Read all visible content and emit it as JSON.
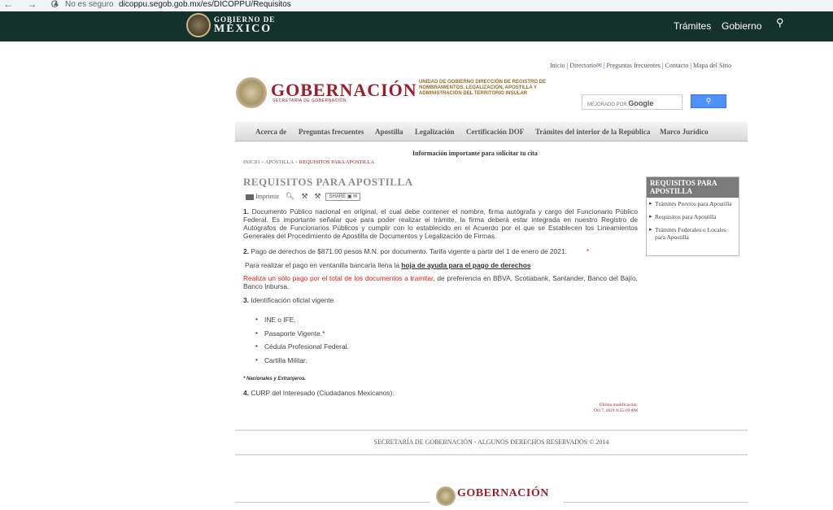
{
  "browser": {
    "nav": "← → C",
    "security": "No es seguro",
    "url": "dicoppu.segob.gob.mx/es/DICOPPU/Requisitos"
  },
  "govbar": {
    "line1": "GOBIERNO DE",
    "line2": "MÉXICO",
    "links": [
      "Trámites",
      "Gobierno"
    ],
    "search_icon": "search-icon"
  },
  "toplinks": [
    "Inicio",
    "Directorio",
    "Preguntas frecuentes",
    "Contacto",
    "Mapa del Sitio"
  ],
  "header": {
    "title": "GOBERNACIÓN",
    "subtitle": "SECRETARÍA DE GOBERNACIÓN",
    "unidad": "UNIDAD DE GOBIERNO DIRECCIÓN DE REGISTRO DE NOMBRAMIENTOS, LEGALIZACIÓN, APOSTILLA Y ADMINISTRACIÓN DEL TERRITORIO INSULAR",
    "search_label": "MEJORADO POR",
    "search_brand": "Google"
  },
  "menu": [
    "Acerca de",
    "Preguntas frecuentes",
    "Apostilla",
    "Legalización",
    "Certificación DOF",
    "Trámites del interior de la República",
    "Marco Jurídico"
  ],
  "info_cita": "Información importante para solicitar tu cita",
  "breadcrumb": {
    "items": [
      "INICIO",
      "APOSTILLA"
    ],
    "current": "REQUISITOS PARA APOSTILLA"
  },
  "page_title": "REQUISITOS PARA APOSTILLA",
  "tools": {
    "print": "Imprimir",
    "share": "SHARE"
  },
  "content": {
    "p1_num": "1.",
    "p1": "Documento Público nacional en original, el cual debe contener el nombre, firma autógrafa y cargo del Funcionario Público Federal. Es importante señalar que para poder realizar el trámite, la firma deberá estar integrada en nuestro Registro de Autógrafos de Funcionarios Públicos y cumplir con lo establecido en el Acuerdo por el que se Establecen los Lineamientos Generales del Procedimiento de Apostilla de Documentos y Legalización de Firmas.",
    "p2_num": "2.",
    "p2": "Pago de derechos de $871.00 pesos M.N. por documento. Tarifa vigente a partir del 1 de enero de 2021.",
    "p2_star": "*",
    "p3_pre": "Para realizar el pago en ventanilla bancaria llena la",
    "p3_link": "hoja de ayuda para el pago de derechos",
    "p4_red": "Realiza un sólo pago por el total de los documentos a tramitar",
    "p4_rest": ", de preferencia en BBVA, Scotiabank, Santander, Banco del Bajío, Banco Inbursa.",
    "p5_num": "3.",
    "p5": "Identificación oficial vigente",
    "ids": [
      "INE o IFE.",
      "Pasaporte Vigente.*",
      "Cédula Profesional Federal.",
      "Cartilla Militar."
    ],
    "note": "* Nacionales y Extranjeros.",
    "p6_num": "4.",
    "p6": "CURP del Interesado (Ciudadanos Mexicanos).",
    "lastmod_label": "Última modificación:",
    "lastmod_date": "Oct 7, 2021 6:55:18 AM"
  },
  "sidebox": {
    "title": "REQUISITOS PARA APOSTILLA",
    "items": [
      "Trámites Previos para Apostilla",
      "Requisitos para Apostilla",
      "Trámites Federales o Locales para Apostilla"
    ]
  },
  "footer": {
    "rights": "SECRETARÍA DE GOBERNACIÓN - ALGUNOS DERECHOS RESERVADOS © 2014",
    "title": "GOBERNACIÓN"
  }
}
